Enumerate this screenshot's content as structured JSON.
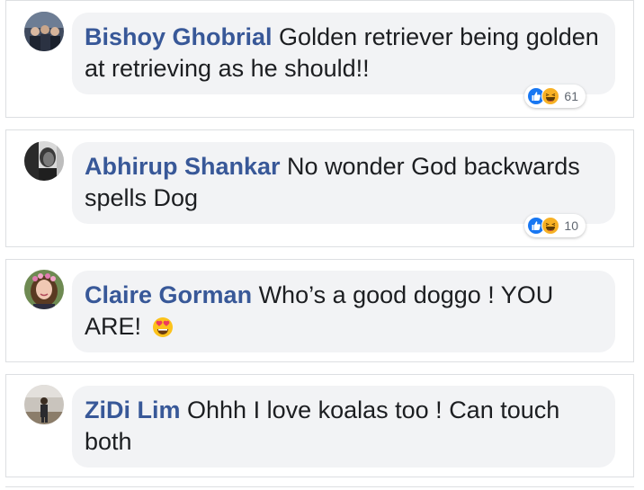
{
  "comments": [
    {
      "author": "Bishoy Ghobrial",
      "text": "Golden retriever being golden at retrieving as he should!!",
      "reactions": [
        "like-icon",
        "haha-icon"
      ],
      "reaction_count": "61"
    },
    {
      "author": "Abhirup Shankar",
      "text": "No wonder God backwards spells Dog",
      "reactions": [
        "like-icon",
        "haha-icon"
      ],
      "reaction_count": "10"
    },
    {
      "author": "Claire Gorman",
      "text": "Who’s a good doggo ! YOU ARE!",
      "inline_emoji": "heart-eyes-emoji-icon"
    },
    {
      "author": "ZiDi Lim",
      "text": "Ohhh I love koalas too ! Can touch both"
    }
  ],
  "colors": {
    "author_link": "#385898",
    "bubble_bg": "#f2f3f5",
    "text": "#1c1e21",
    "like_blue": "#1877f2",
    "haha_yellow": "#f7b125"
  }
}
